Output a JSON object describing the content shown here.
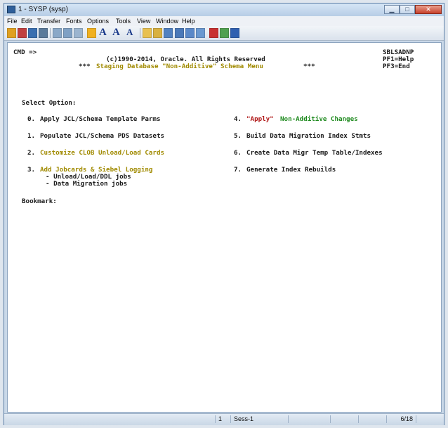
{
  "window": {
    "title": "1 - SYSP (sysp)"
  },
  "menubar": [
    "File",
    "Edit",
    "Transfer",
    "Fonts",
    "Options",
    "Tools",
    "View",
    "Window",
    "Help"
  ],
  "toolbar": {
    "font_a": "A",
    "font_a2": "A",
    "font_a3": "A"
  },
  "terminal": {
    "cmd_prompt": "CMD =>",
    "panel_id": "SBLSADNP",
    "copyright": "(c)1990-2014, Oracle. All Rights Reserved",
    "pf1": "PF1=Help",
    "menu_title_prefix": "***",
    "menu_title": "Staging Database \"Non-Additive\" Schema Menu",
    "menu_title_suffix": "***",
    "pf3": "PF3=End",
    "select_option": "Select Option:",
    "options": [
      {
        "num": "0.",
        "label": "Apply JCL/Schema Template Parms"
      },
      {
        "num": "1.",
        "label": "Populate JCL/Schema PDS Datasets"
      },
      {
        "num": "2.",
        "label": "Customize CLOB Unload/Load Cards"
      },
      {
        "num": "3.",
        "label": "Add Jobcards & Siebel Logging"
      },
      {
        "num": "4.",
        "label_quoted": "\"Apply\"",
        "label": "Non-Additive Changes"
      },
      {
        "num": "5.",
        "label": "Build Data Migration Index Stmts"
      },
      {
        "num": "6.",
        "label": "Create Data Migr Temp Table/Indexes"
      },
      {
        "num": "7.",
        "label": "Generate Index Rebuilds"
      }
    ],
    "sub3a": "- Unload/Load/DDL jobs",
    "sub3b": "- Data Migration jobs",
    "bookmark": "Bookmark:"
  },
  "statusbar": {
    "session_num": "1",
    "session": "Sess-1",
    "position": "6/18"
  },
  "colors": {
    "green": "#1e8a1e",
    "yellow": "#a08a00",
    "red": "#b01818",
    "accent": "#2f5f9a"
  }
}
